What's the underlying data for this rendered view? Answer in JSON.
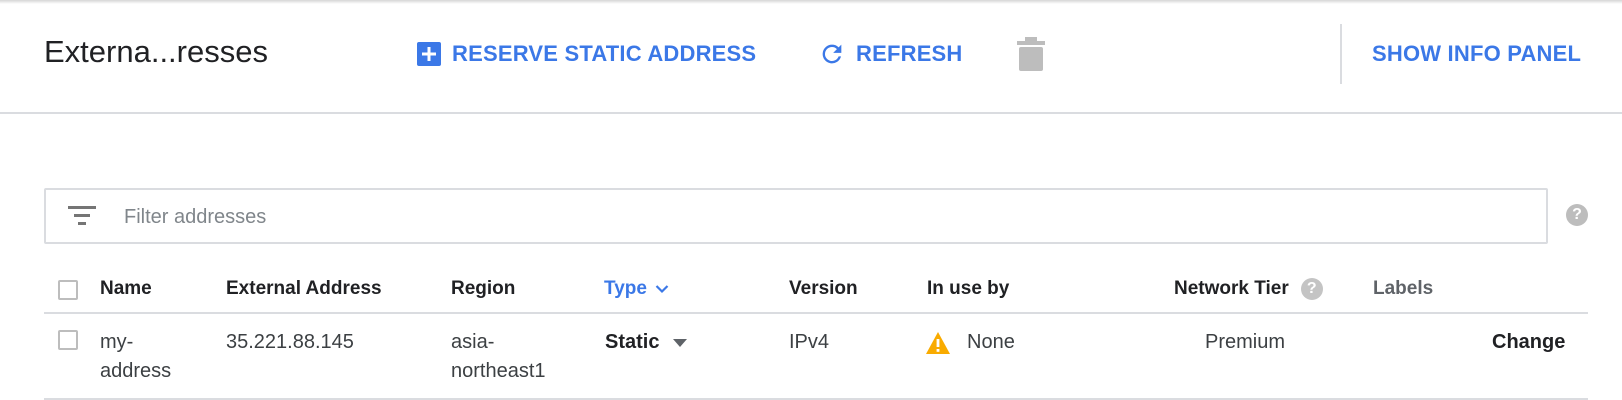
{
  "header": {
    "title": "Externa...resses",
    "reserve_label": "RESERVE STATIC ADDRESS",
    "refresh_label": "REFRESH",
    "info_panel_label": "SHOW INFO PANEL"
  },
  "filter": {
    "placeholder": "Filter addresses"
  },
  "table": {
    "columns": {
      "name": "Name",
      "external_address": "External Address",
      "region": "Region",
      "type": "Type",
      "version": "Version",
      "in_use_by": "In use by",
      "network_tier": "Network Tier",
      "labels": "Labels"
    },
    "rows": [
      {
        "name_line1": "my-",
        "name_line2": "address",
        "external_address": "35.221.88.145",
        "region_line1": "asia-",
        "region_line2": "northeast1",
        "type": "Static",
        "version": "IPv4",
        "in_use_by": "None",
        "network_tier": "Premium",
        "action": "Change"
      }
    ]
  },
  "colors": {
    "accent": "#3b78e7",
    "warning": "#f9ab00",
    "divider": "#dadce0",
    "icon_gray": "#bdbdbd"
  }
}
